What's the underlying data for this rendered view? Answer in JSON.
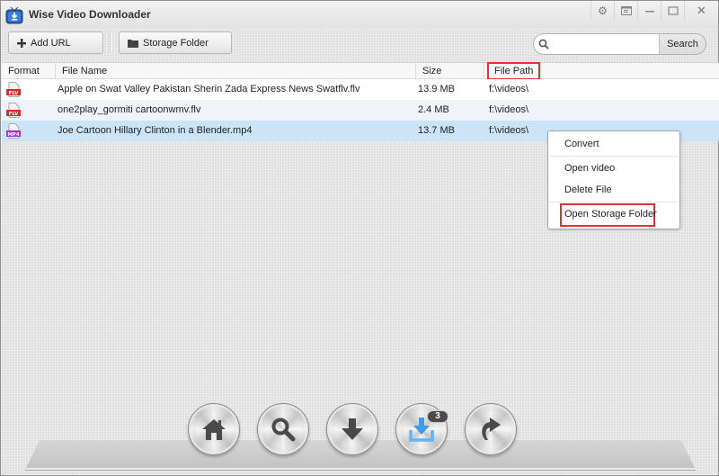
{
  "app": {
    "title": "Wise Video Downloader",
    "icon": "tv-download-icon"
  },
  "window_controls": [
    {
      "name": "settings",
      "icon": "gear-icon"
    },
    {
      "name": "skin",
      "icon": "skin-icon"
    },
    {
      "name": "minimize",
      "icon": "minimize-icon"
    },
    {
      "name": "maximize",
      "icon": "maximize-icon"
    },
    {
      "name": "close",
      "icon": "close-icon"
    }
  ],
  "toolbar": {
    "add_url_label": "Add URL",
    "storage_folder_label": "Storage Folder",
    "search": {
      "placeholder": "",
      "value": "",
      "button_label": "Search"
    }
  },
  "table": {
    "columns": [
      "Format",
      "File Name",
      "Size",
      "File Path"
    ],
    "highlighted_column": "File Path",
    "rows": [
      {
        "format": "FLV",
        "name": "Apple on Swat Valley Pakistan Sherin Zada Express News Swatflv.flv",
        "size": "13.9 MB",
        "path": "f:\\videos\\",
        "selected": false
      },
      {
        "format": "FLV",
        "name": "one2play_gormiti cartoonwmv.flv",
        "size": "2.4 MB",
        "path": "f:\\videos\\",
        "selected": false
      },
      {
        "format": "MP4",
        "name": "Joe Cartoon  Hillary Clinton in a Blender.mp4",
        "size": "13.7 MB",
        "path": "f:\\videos\\",
        "selected": true
      }
    ]
  },
  "context_menu": {
    "items": [
      "Convert",
      "Open video",
      "Delete File",
      "Open Storage Folder"
    ],
    "highlighted_item": "Open Storage Folder"
  },
  "dock": {
    "buttons": [
      {
        "name": "home",
        "icon": "home-icon"
      },
      {
        "name": "search",
        "icon": "magnifier-icon"
      },
      {
        "name": "download",
        "icon": "download-arrow-icon"
      },
      {
        "name": "downloaded",
        "icon": "downloaded-tray-icon",
        "badge": "3",
        "active": true
      },
      {
        "name": "convert",
        "icon": "convert-arrow-icon"
      }
    ]
  },
  "colors": {
    "selected_row": "#cce4f7",
    "alt_row": "#f0f4fa",
    "highlight_box": "#e63030",
    "flv_badge": "#d42a2a",
    "mp4_badge": "#a32fd0",
    "active_dock_icon": "#3d9be9"
  }
}
